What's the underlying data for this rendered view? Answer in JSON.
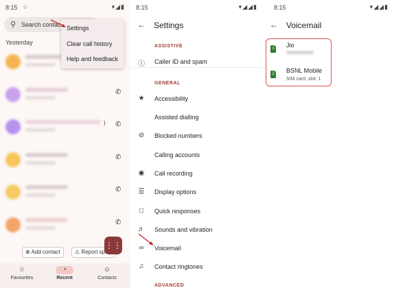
{
  "panel1": {
    "status_time": "8:15",
    "status_icons": "▾◢▮",
    "status_extra": "○",
    "search_icon": "search-icon",
    "search_text": "Search contacts",
    "menu": [
      "Settings",
      "Clear call history",
      "Help and feedback"
    ],
    "section": "Yesterday",
    "row_extra_text": ")",
    "add_contact": "Add contact",
    "report_spam": "Report spam",
    "dialpad_icon": "dialpad-icon",
    "nav": [
      {
        "label": "Favourites",
        "icon": "star-icon"
      },
      {
        "label": "Recent",
        "icon": "clock-icon"
      },
      {
        "label": "Contacts",
        "icon": "people-icon"
      }
    ]
  },
  "panel2": {
    "status_time": "8:15",
    "status_icons": "▾◢◢▮",
    "title": "Settings",
    "section_assistive": "ASSISTIVE",
    "item_caller_id": "Caller ID and spam",
    "section_general": "GENERAL",
    "items": [
      "Accessibility",
      "Assisted dialling",
      "Blocked numbers",
      "Calling accounts",
      "Call recording",
      "Display options",
      "Quick responses",
      "Sounds and vibration",
      "Voicemail",
      "Contact ringtones"
    ],
    "section_advanced": "ADVANCED"
  },
  "panel3": {
    "status_time": "8:15",
    "status_icons": "▾◢◢▮",
    "title": "Voicemail",
    "sims": [
      {
        "slot": "1",
        "name": "Jio",
        "subtitle": ""
      },
      {
        "slot": "2",
        "name": "BSNL Mobile",
        "subtitle": "SIM card, slot: 1"
      }
    ]
  },
  "colors": {
    "accent": "#a03a2e",
    "highlight_box": "#d9534f",
    "sim": "#2e7d32",
    "fab": "#8b3a3a"
  }
}
